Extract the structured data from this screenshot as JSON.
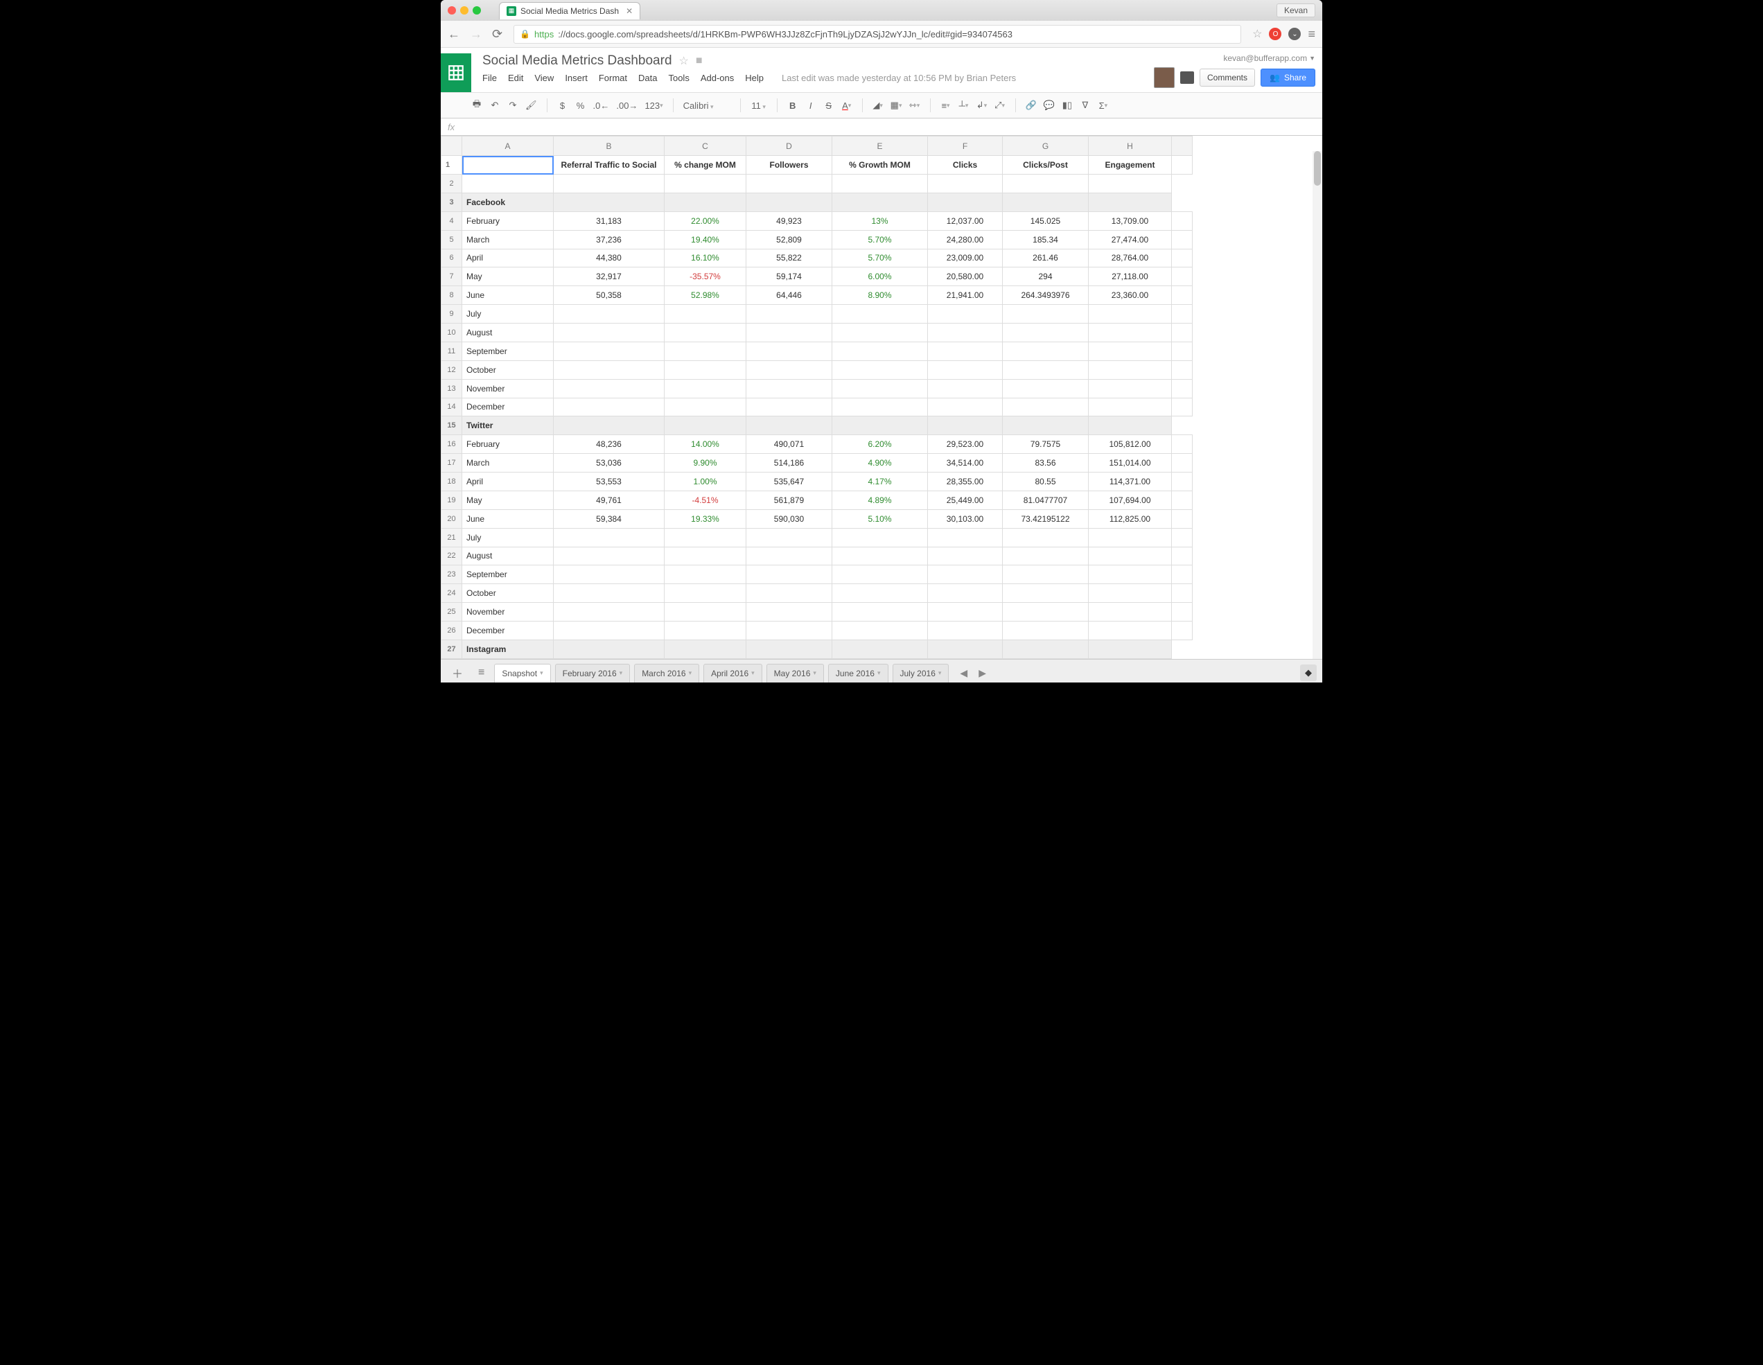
{
  "chrome": {
    "tab_title": "Social Media Metrics Dash",
    "user_chip": "Kevan",
    "url_https": "https",
    "url_host": "://docs.google.com",
    "url_path": "/spreadsheets/d/1HRKBm-PWP6WH3JJz8ZcFjnTh9LjyDZASjJ2wYJJn_lc/edit#gid=934074563"
  },
  "doc": {
    "title": "Social Media Metrics Dashboard",
    "email": "kevan@bufferapp.com",
    "menus": [
      "File",
      "Edit",
      "View",
      "Insert",
      "Format",
      "Data",
      "Tools",
      "Add-ons",
      "Help"
    ],
    "history": "Last edit was made yesterday at 10:56 PM by Brian Peters",
    "comments_btn": "Comments",
    "share_btn": "Share"
  },
  "toolbar": {
    "font": "Calibri",
    "size": "11",
    "fmt123": "123",
    "currency": "$",
    "percent": "%"
  },
  "fx": {
    "label": "fx"
  },
  "columns": [
    "A",
    "B",
    "C",
    "D",
    "E",
    "F",
    "G",
    "H"
  ],
  "headers": [
    "",
    "Referral Traffic to Social",
    "% change MOM",
    "Followers",
    "% Growth MOM",
    "Clicks",
    "Clicks/Post",
    "Engagement"
  ],
  "sections": [
    {
      "name": "Facebook",
      "row_num": 3,
      "rows": [
        {
          "n": 4,
          "month": "February",
          "b": "31,183",
          "c": "22.00%",
          "cc": "pos",
          "d": "49,923",
          "e": "13%",
          "ec": "pos",
          "f": "12,037.00",
          "g": "145.025",
          "h": "13,709.00"
        },
        {
          "n": 5,
          "month": "March",
          "b": "37,236",
          "c": "19.40%",
          "cc": "pos",
          "d": "52,809",
          "e": "5.70%",
          "ec": "pos",
          "f": "24,280.00",
          "g": "185.34",
          "h": "27,474.00"
        },
        {
          "n": 6,
          "month": "April",
          "b": "44,380",
          "c": "16.10%",
          "cc": "pos",
          "d": "55,822",
          "e": "5.70%",
          "ec": "pos",
          "f": "23,009.00",
          "g": "261.46",
          "h": "28,764.00"
        },
        {
          "n": 7,
          "month": "May",
          "b": "32,917",
          "c": "-35.57%",
          "cc": "neg",
          "d": "59,174",
          "e": "6.00%",
          "ec": "pos",
          "f": "20,580.00",
          "g": "294",
          "h": "27,118.00"
        },
        {
          "n": 8,
          "month": "June",
          "b": "50,358",
          "c": "52.98%",
          "cc": "pos",
          "d": "64,446",
          "e": "8.90%",
          "ec": "pos",
          "f": "21,941.00",
          "g": "264.3493976",
          "h": "23,360.00"
        },
        {
          "n": 9,
          "month": "July"
        },
        {
          "n": 10,
          "month": "August"
        },
        {
          "n": 11,
          "month": "September"
        },
        {
          "n": 12,
          "month": "October"
        },
        {
          "n": 13,
          "month": "November"
        },
        {
          "n": 14,
          "month": "December"
        }
      ]
    },
    {
      "name": "Twitter",
      "row_num": 15,
      "rows": [
        {
          "n": 16,
          "month": "February",
          "b": "48,236",
          "c": "14.00%",
          "cc": "pos",
          "d": "490,071",
          "e": "6.20%",
          "ec": "pos",
          "f": "29,523.00",
          "g": "79.7575",
          "h": "105,812.00"
        },
        {
          "n": 17,
          "month": "March",
          "b": "53,036",
          "c": "9.90%",
          "cc": "pos",
          "d": "514,186",
          "e": "4.90%",
          "ec": "pos",
          "f": "34,514.00",
          "g": "83.56",
          "h": "151,014.00"
        },
        {
          "n": 18,
          "month": "April",
          "b": "53,553",
          "c": "1.00%",
          "cc": "pos",
          "d": "535,647",
          "e": "4.17%",
          "ec": "pos",
          "f": "28,355.00",
          "g": "80.55",
          "h": "114,371.00"
        },
        {
          "n": 19,
          "month": "May",
          "b": "49,761",
          "c": "-4.51%",
          "cc": "neg",
          "d": "561,879",
          "e": "4.89%",
          "ec": "pos",
          "f": "25,449.00",
          "g": "81.0477707",
          "h": "107,694.00"
        },
        {
          "n": 20,
          "month": "June",
          "b": "59,384",
          "c": "19.33%",
          "cc": "pos",
          "d": "590,030",
          "e": "5.10%",
          "ec": "pos",
          "f": "30,103.00",
          "g": "73.42195122",
          "h": "112,825.00"
        },
        {
          "n": 21,
          "month": "July"
        },
        {
          "n": 22,
          "month": "August"
        },
        {
          "n": 23,
          "month": "September"
        },
        {
          "n": 24,
          "month": "October"
        },
        {
          "n": 25,
          "month": "November"
        },
        {
          "n": 26,
          "month": "December"
        }
      ]
    },
    {
      "name": "Instagram",
      "row_num": 27,
      "rows": []
    }
  ],
  "sheet_tabs": {
    "active": "Snapshot",
    "tabs": [
      "Snapshot",
      "February 2016",
      "March 2016",
      "April 2016",
      "May 2016",
      "June 2016",
      "July 2016"
    ]
  }
}
